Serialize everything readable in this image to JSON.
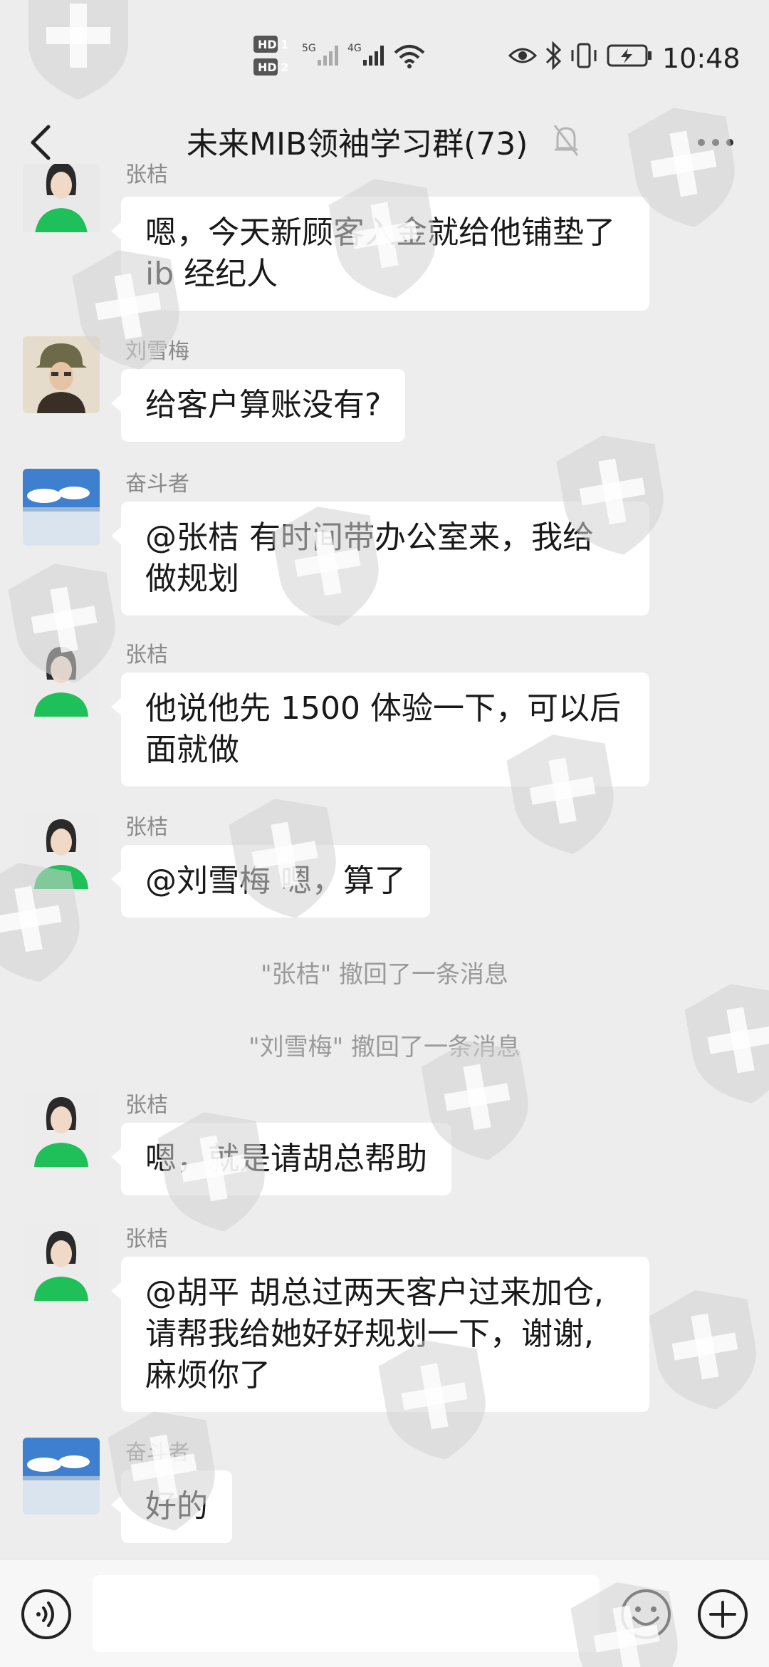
{
  "status_bar": {
    "hd1": "HD 1",
    "hd2": "HD 2",
    "net1": "5G",
    "net2": "4G",
    "time": "10:48"
  },
  "header": {
    "title": "未来MIB领袖学习群(73)"
  },
  "messages": [
    {
      "sender": "张桔",
      "text_lines": [
        "嗯，今天新顾客入金就给他铺垫了",
        "ib 经纪人"
      ],
      "avatar": "woman-green-avatar"
    },
    {
      "sender": "刘雪梅",
      "text_lines": [
        "给客户算账没有?"
      ],
      "avatar": "woman-hat-avatar"
    },
    {
      "sender": "奋斗者",
      "text_lines": [
        "@张桔  有时间带办公室来，我给",
        "做规划"
      ],
      "avatar": "sky-sea-avatar"
    },
    {
      "sender": "张桔",
      "text_lines": [
        "他说他先 1500 体验一下，可以后",
        "面就做"
      ],
      "avatar": "woman-green-avatar"
    },
    {
      "sender": "张桔",
      "text_lines": [
        "@刘雪梅  嗯，算了"
      ],
      "avatar": "woman-green-avatar"
    },
    {
      "sender": "张桔",
      "text_lines": [
        "嗯，就是请胡总帮助"
      ],
      "avatar": "woman-green-avatar"
    },
    {
      "sender": "张桔",
      "text_lines": [
        "@胡平  胡总过两天客户过来加仓,",
        "请帮我给她好好规划一下，谢谢,",
        "麻烦你了"
      ],
      "avatar": "woman-green-avatar"
    },
    {
      "sender": "奋斗者",
      "text_lines": [
        "好的"
      ],
      "avatar": "sky-sea-avatar"
    }
  ],
  "system_messages": [
    "\"张桔\" 撤回了一条消息",
    "\"刘雪梅\" 撤回了一条消息"
  ],
  "icons": {
    "back": "chevron-left-icon",
    "mute": "bell-off-icon",
    "more": "more-icon",
    "voice": "voice-icon",
    "emoji": "emoji-icon",
    "plus": "plus-icon"
  },
  "colors": {
    "background": "#ededed",
    "bubble": "#ffffff",
    "avatar_green": "#1fbf5a",
    "watermark": "#d0d0d0"
  }
}
